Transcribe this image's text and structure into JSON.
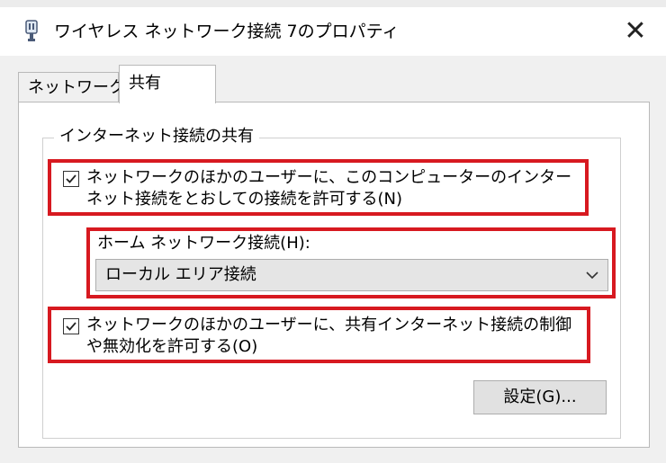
{
  "window": {
    "title": "ワイヤレス ネットワーク接続 7のプロパティ",
    "close_glyph": "✕",
    "icon": "network-adapter-icon"
  },
  "tabs": [
    {
      "label": "ネットワーク",
      "selected": false
    },
    {
      "label": "共有",
      "selected": true
    }
  ],
  "sharing": {
    "group_label": "インターネット接続の共有",
    "allow_connect": {
      "label": "ネットワークのほかのユーザーに、このコンピューターのインターネット接続をとおしての接続を許可する(N)",
      "checked": true
    },
    "home_network": {
      "label": "ホーム ネットワーク接続(H):",
      "selected_value": "ローカル エリア接続"
    },
    "allow_control": {
      "label": "ネットワークのほかのユーザーに、共有インターネット接続の制御や無効化を許可する(O)",
      "checked": true
    },
    "settings_button": "設定(G)..."
  },
  "colors": {
    "highlight": "#d71920",
    "panel": "#ffffff",
    "window_bg": "#f0f0f0"
  }
}
